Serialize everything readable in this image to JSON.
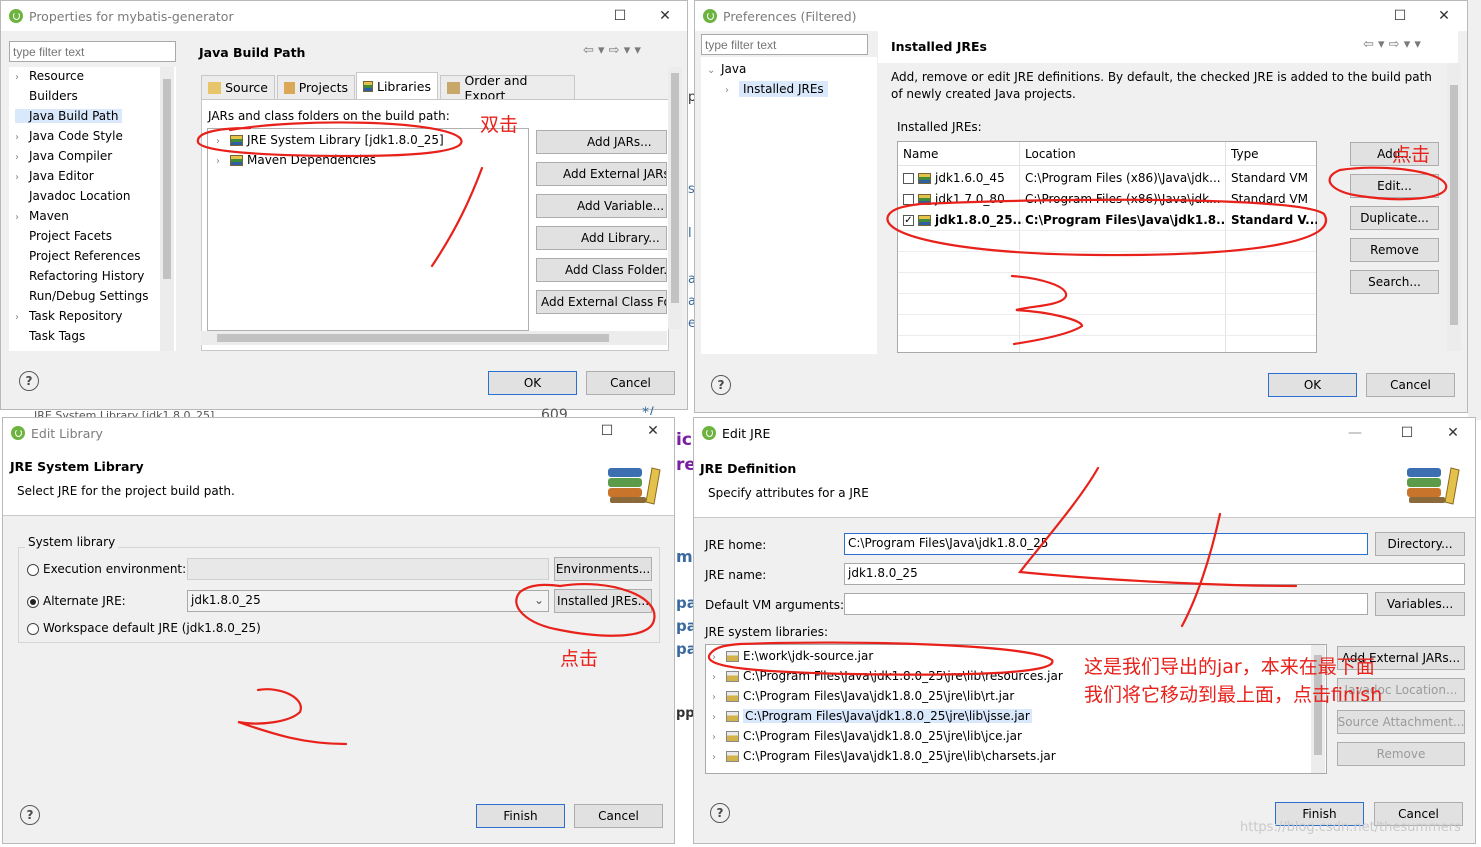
{
  "w1": {
    "title": "Properties for mybatis-generator",
    "filter_placeholder": "type filter text",
    "nav": [
      "Resource",
      "Builders",
      "Java Build Path",
      "Java Code Style",
      "Java Compiler",
      "Java Editor",
      "Javadoc Location",
      "Maven",
      "Project Facets",
      "Project References",
      "Refactoring History",
      "Run/Debug Settings",
      "Task Repository",
      "Task Tags"
    ],
    "header": "Java Build Path",
    "tabs": [
      "Source",
      "Projects",
      "Libraries",
      "Order and Export"
    ],
    "label": "JARs and class folders on the build path:",
    "tree": [
      "JRE System Library [jdk1.8.0_25]",
      "Maven Dependencies"
    ],
    "buttons": [
      "Add JARs...",
      "Add External JARs...",
      "Add Variable...",
      "Add Library...",
      "Add Class Folder...",
      "Add External Class Folder..."
    ],
    "ok": "OK",
    "cancel": "Cancel",
    "side_letters": [
      "p",
      "s",
      "l",
      "a",
      "a",
      "e"
    ]
  },
  "w2": {
    "title": "Preferences (Filtered)",
    "filter_placeholder": "type filter text",
    "tree": [
      "Java",
      "Installed JREs"
    ],
    "header": "Installed JREs",
    "desc": "Add, remove or edit JRE definitions. By default, the checked JRE is added to the build path of newly created Java projects.",
    "list_label": "Installed JREs:",
    "cols": [
      "Name",
      "Location",
      "Type"
    ],
    "rows": [
      {
        "name": "jdk1.6.0_45",
        "loc": "C:\\Program Files (x86)\\Java\\jdk...",
        "type": "Standard VM",
        "checked": false
      },
      {
        "name": "jdk1.7.0_80",
        "loc": "C:\\Program Files (x86)\\Java\\jdk...",
        "type": "Standard VM",
        "checked": false
      },
      {
        "name": "jdk1.8.0_25...",
        "loc": "C:\\Program Files\\Java\\jdk1.8....",
        "type": "Standard V...",
        "checked": true
      }
    ],
    "buttons": [
      "Add...",
      "Edit...",
      "Duplicate...",
      "Remove",
      "Search..."
    ],
    "ok": "OK",
    "cancel": "Cancel"
  },
  "w3": {
    "title": "Edit Library",
    "header": "JRE System Library",
    "sub": "Select JRE for the project build path.",
    "group": "System library",
    "opt_exec": "Execution environment:",
    "opt_alt": "Alternate JRE:",
    "alt_value": "jdk1.8.0_25",
    "opt_ws": "Workspace default JRE (jdk1.8.0_25)",
    "btn_env": "Environments...",
    "btn_inst": "Installed JREs...",
    "finish": "Finish",
    "cancel": "Cancel",
    "bg_text": "JRE System Library [jdk1.8.0_25]"
  },
  "w4": {
    "title": "Edit JRE",
    "header": "JRE Definition",
    "sub": "Specify attributes for a JRE",
    "home_label": "JRE home:",
    "home_value": "C:\\Program Files\\Java\\jdk1.8.0_25",
    "name_label": "JRE name:",
    "name_value": "jdk1.8.0_25",
    "vm_label": "Default VM arguments:",
    "libs_label": "JRE system libraries:",
    "libs": [
      "E:\\work\\jdk-source.jar",
      "C:\\Program Files\\Java\\jdk1.8.0_25\\jre\\lib\\resources.jar",
      "C:\\Program Files\\Java\\jdk1.8.0_25\\jre\\lib\\rt.jar",
      "C:\\Program Files\\Java\\jdk1.8.0_25\\jre\\lib\\jsse.jar",
      "C:\\Program Files\\Java\\jdk1.8.0_25\\jre\\lib\\jce.jar",
      "C:\\Program Files\\Java\\jdk1.8.0_25\\jre\\lib\\charsets.jar"
    ],
    "btn_dir": "Directory...",
    "btn_vars": "Variables...",
    "btn_add_ext": "Add External JARs...",
    "btn_javadoc": "Javadoc Location...",
    "btn_src": "Source Attachment...",
    "btn_remove": "Remove",
    "finish": "Finish",
    "cancel": "Cancel",
    "watermark": "https://blog.csdn.net/thesummers"
  },
  "annotations": {
    "dbl": "双击",
    "click": "点击",
    "note1": "这是我们导出的jar，本来在最下面",
    "note2": "我们将它移动到最上面，点击finish"
  },
  "bg_code": [
    "ic",
    "re",
    "mp",
    "pa",
    "pa",
    "pa",
    "ppl",
    "609",
    "*/"
  ]
}
